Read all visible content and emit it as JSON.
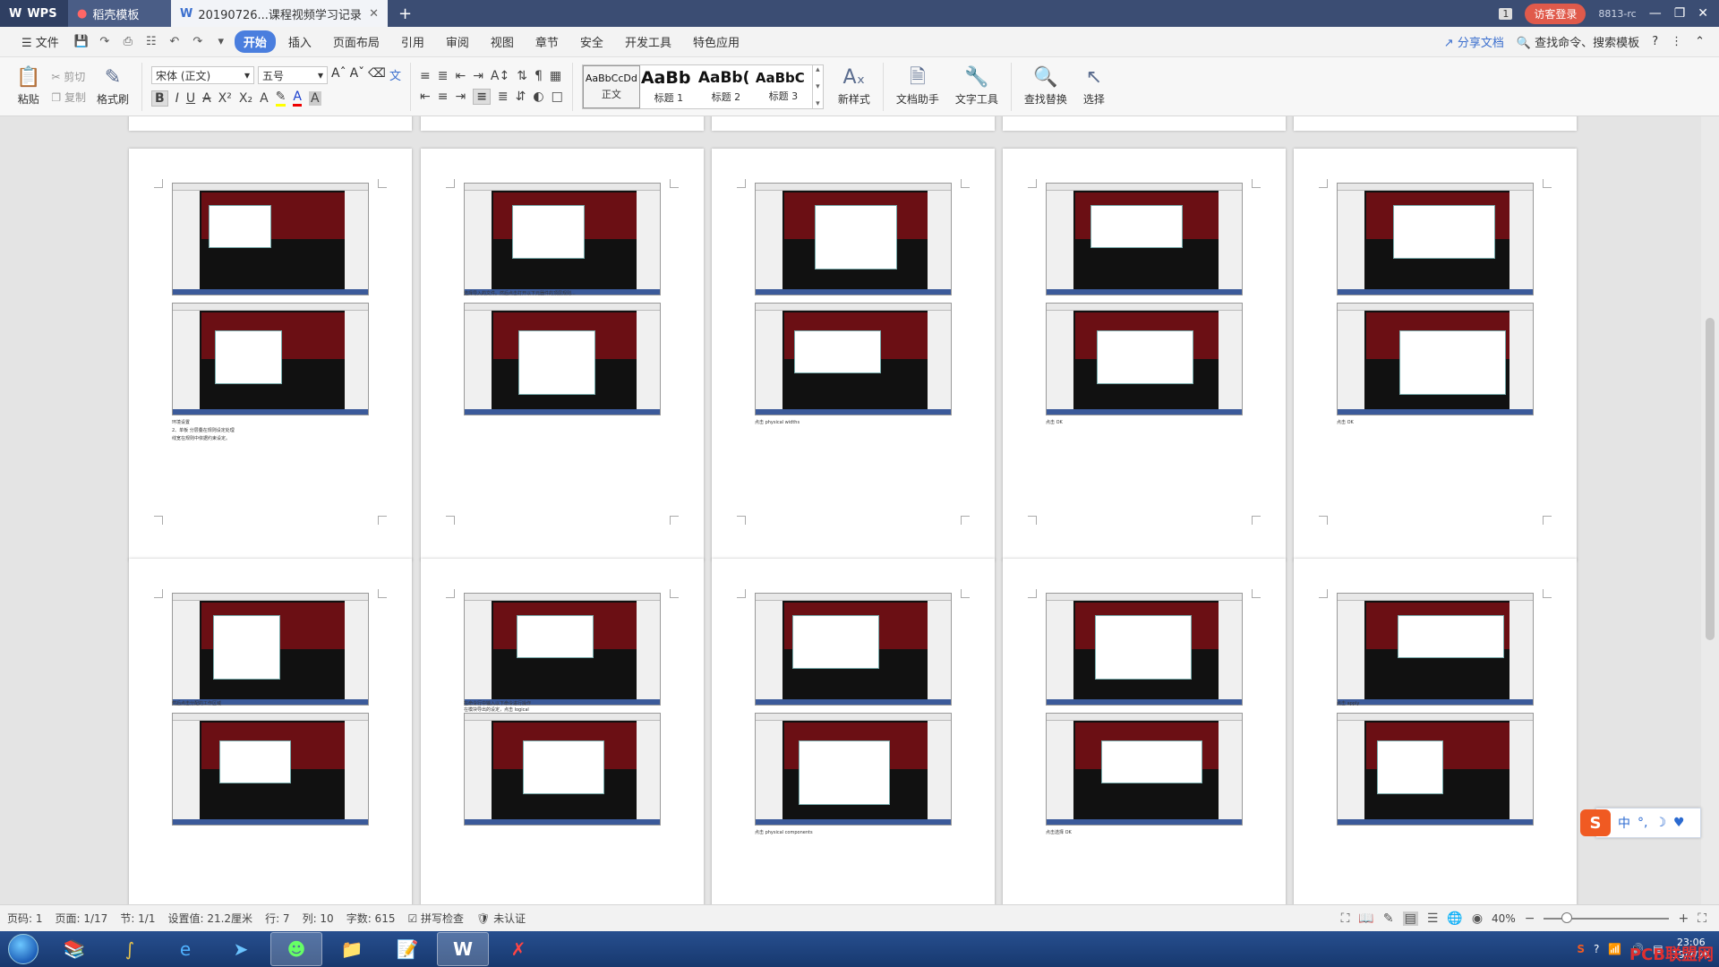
{
  "titlebar": {
    "wps_label": "WPS",
    "tabs": [
      {
        "label": "稻壳模板"
      },
      {
        "label": "20190726...课程视频学习记录"
      }
    ],
    "new_tab": "+",
    "page_count_badge": "1",
    "login_label": "访客登录",
    "user_id": "8813-rc"
  },
  "menubar": {
    "file_label": "文件",
    "items": [
      "开始",
      "插入",
      "页面布局",
      "引用",
      "审阅",
      "视图",
      "章节",
      "安全",
      "开发工具",
      "特色应用"
    ],
    "active_item": "开始",
    "share_label": "分享文档",
    "search_label": "查找命令、搜索模板"
  },
  "ribbon": {
    "paste_label": "粘贴",
    "cut_label": "剪切",
    "copy_label": "复制",
    "format_painter_label": "格式刷",
    "font_name": "宋体 (正文)",
    "font_size": "五号",
    "styles": [
      {
        "sample": "AaBbCcDd",
        "label": "正文"
      },
      {
        "sample": "AaBb",
        "label": "标题 1"
      },
      {
        "sample": "AaBb(",
        "label": "标题 2"
      },
      {
        "sample": "AaBbC",
        "label": "标题 3"
      }
    ],
    "new_style_label": "新样式",
    "doc_helper_label": "文档助手",
    "text_tools_label": "文字工具",
    "find_replace_label": "查找替换",
    "select_label": "选择"
  },
  "document": {
    "captions": [
      [
        "环境设置",
        "2、单板 分层叠在规则设定处理",
        "线宽在规则中依据约束设定。"
      ],
      [
        "选择导入的文件。然后点击打开以下元器件的顶层规则..."
      ],
      [
        "点击 physical widths"
      ],
      [
        "点击 OK"
      ],
      [
        "点击 OK"
      ],
      [
        "然后点击分配的工作区域"
      ],
      [
        "在命令行中输入以下命令进行操作",
        "在模块导出的设定，点击 logical"
      ],
      [
        "点击 physical components"
      ],
      [
        "点击选择 OK"
      ],
      [
        "点击 apply"
      ]
    ]
  },
  "ime": {
    "logo": "S",
    "mode": "中"
  },
  "statusbar": {
    "page_no": "页码: 1",
    "pages": "页面: 1/17",
    "section": "节: 1/1",
    "position": "设置值: 21.2厘米",
    "row": "行: 7",
    "col": "列: 10",
    "word_count": "字数: 615",
    "spell_check": "拼写检查",
    "auth": "未认证",
    "zoom": "40%"
  },
  "taskbar": {
    "time": "23:06",
    "date": "19/7/26",
    "watermark": "PCB联盟网"
  },
  "colors": {
    "titlebar": "#3b4d73",
    "accent": "#4a7ede",
    "pcb_red": "#6b0f14",
    "login": "#e05a4b"
  }
}
